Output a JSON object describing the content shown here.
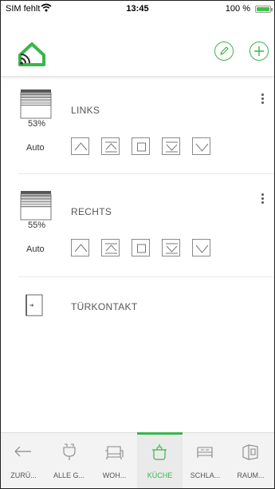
{
  "status_bar": {
    "carrier": "SIM fehlt",
    "time": "13:45",
    "battery": "100 %"
  },
  "header": {
    "logo_icon": "home-wifi-logo-icon",
    "edit_icon": "pencil-icon",
    "add_icon": "plus-icon",
    "accent_color": "#3ab54a"
  },
  "devices": {
    "links": {
      "name": "LINKS",
      "position": "53%",
      "mode": "Auto",
      "icon": "roller-shutter-icon"
    },
    "rechts": {
      "name": "RECHTS",
      "position": "55%",
      "mode": "Auto",
      "icon": "roller-shutter-icon"
    },
    "door": {
      "name": "TÜRKONTAKT",
      "icon": "door-icon"
    }
  },
  "controls": [
    "up-icon",
    "up-to-limit-icon",
    "stop-icon",
    "down-to-limit-icon",
    "down-icon"
  ],
  "tabs": [
    {
      "label": "ZURÜ...",
      "icon": "back-arrow-icon"
    },
    {
      "label": "ALLE G...",
      "icon": "plug-icon"
    },
    {
      "label": "WOH...",
      "icon": "sofa-icon"
    },
    {
      "label": "KÜCHE",
      "icon": "pot-icon",
      "active": true
    },
    {
      "label": "SCHLA...",
      "icon": "bed-icon"
    },
    {
      "label": "RAUM...",
      "icon": "room-icon"
    }
  ]
}
